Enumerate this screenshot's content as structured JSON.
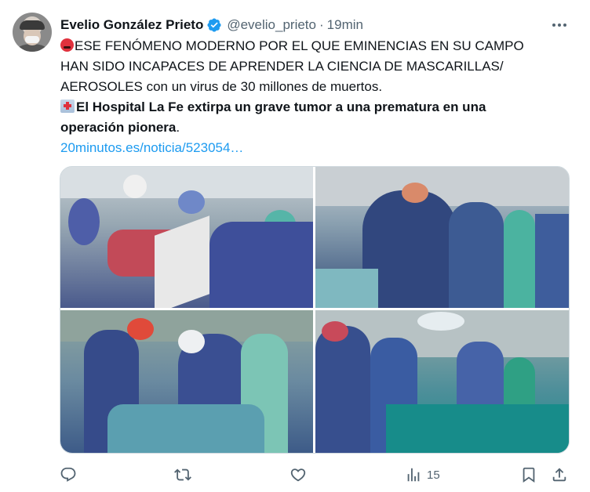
{
  "author": {
    "name": "Evelio González Prieto",
    "handle": "@evelio_prieto",
    "separator": "·",
    "time": "19min"
  },
  "post": {
    "line1": "ESE FENÓMENO MODERNO POR EL QUE EMINENCIAS EN SU CAMPO",
    "line2": "HAN SIDO INCAPACES DE APRENDER LA CIENCIA DE MASCARILLAS/",
    "line3": "AEROSOLES con un virus de 30 millones de muertos.",
    "bold_line1": "El Hospital La Fe extirpa un grave tumor a una prematura en una",
    "bold_line2": "operación pionera",
    "bold_suffix": ".",
    "link": "20minutos.es/noticia/523054…"
  },
  "icons": {
    "verified": "verified-badge-icon",
    "angry": "angry-face-emoji",
    "hospital": "hospital-emoji",
    "more": "more-options-icon",
    "reply": "reply-icon",
    "repost": "repost-icon",
    "like": "like-icon",
    "views": "views-icon",
    "bookmark": "bookmark-icon",
    "share": "share-icon"
  },
  "stats": {
    "views": "15"
  },
  "colors": {
    "text": "#0f1419",
    "muted": "#536471",
    "link": "#1d9bf0",
    "verified": "#1d9bf0"
  }
}
